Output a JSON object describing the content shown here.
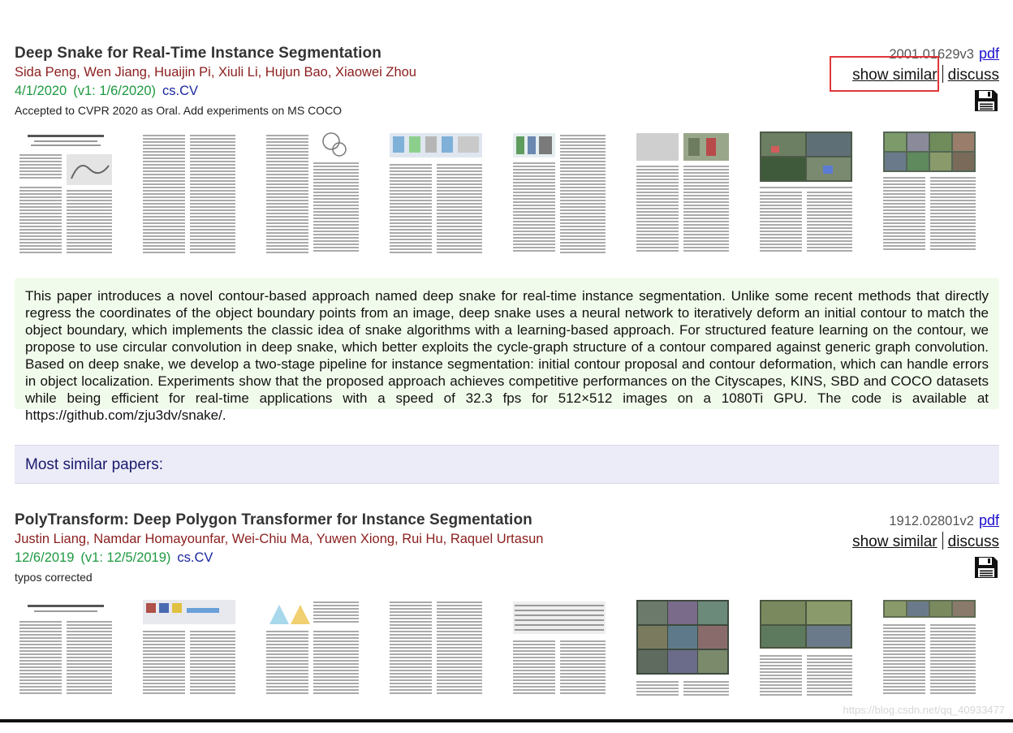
{
  "papers": [
    {
      "title": "Deep Snake for Real-Time Instance Segmentation",
      "authors": "Sida Peng, Wen Jiang, Huaijin Pi, Xiuli Li, Hujun Bao, Xiaowei Zhou",
      "date": "4/1/2020",
      "v1": "(v1: 1/6/2020)",
      "category": "cs.CV",
      "comment": "Accepted to CVPR 2020 as Oral. Add experiments on MS COCO",
      "arxiv_id": "2001.01629v3",
      "pdf_label": "pdf",
      "show_similar_label": "show similar",
      "discuss_label": "discuss",
      "save_icon": "save-icon",
      "abstract": "This paper introduces a novel contour-based approach named deep snake for real-time instance segmentation. Unlike some recent methods that directly regress the coordinates of the object boundary points from an image, deep snake uses a neural network to iteratively deform an initial contour to match the object boundary, which implements the classic idea of snake algorithms with a learning-based approach. For structured feature learning on the contour, we propose to use circular convolution in deep snake, which better exploits the cycle-graph structure of a contour compared against generic graph convolution. Based on deep snake, we develop a two-stage pipeline for instance segmentation: initial contour proposal and contour deformation, which can handle errors in object localization. Experiments show that the proposed approach achieves competitive performances on the Cityscapes, KINS, SBD and COCO datasets while being efficient for real-time applications with a speed of 32.3 fps for 512×512 images on a 1080Ti GPU. The code is available at https://github.com/zju3dv/snake/."
    },
    {
      "title": "PolyTransform: Deep Polygon Transformer for Instance Segmentation",
      "authors": "Justin Liang, Namdar Homayounfar, Wei-Chiu Ma, Yuwen Xiong, Rui Hu, Raquel Urtasun",
      "date": "12/6/2019",
      "v1": "(v1: 12/5/2019)",
      "category": "cs.CV",
      "comment": "typos corrected",
      "arxiv_id": "1912.02801v2",
      "pdf_label": "pdf",
      "show_similar_label": "show similar",
      "discuss_label": "discuss",
      "save_icon": "save-icon"
    }
  ],
  "similar_header": "Most similar papers:",
  "watermark": "https://blog.csdn.net/qq_40933477",
  "colors": {
    "authors": "#8b1e1e",
    "date": "#1e9940",
    "category": "#1a27a0",
    "pdf_link": "#1a0dcc",
    "abstract_bg": "#f1fbeb",
    "similar_bg": "#ececf8",
    "highlight": "#e0373a"
  }
}
